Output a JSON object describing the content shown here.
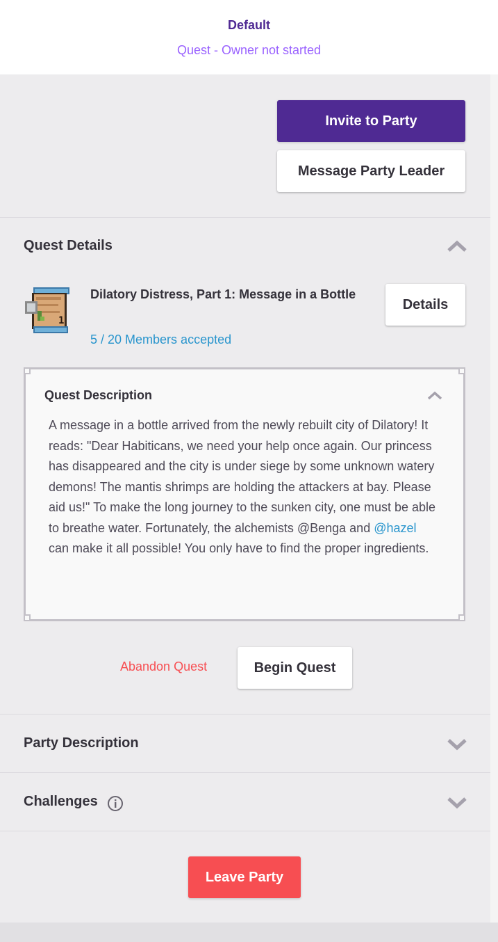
{
  "header": {
    "title": "Default",
    "subtitle": "Quest - Owner not started"
  },
  "actions": {
    "invite_label": "Invite to Party",
    "message_label": "Message Party Leader"
  },
  "quest_section": {
    "title": "Quest Details",
    "quest_name": "Dilatory Distress, Part 1: Message in a Bottle",
    "members_accepted": "5 / 20 Members accepted",
    "details_label": "Details",
    "description_title": "Quest Description",
    "description_part1": "A message in a bottle arrived from the newly rebuilt city of Dilatory! It reads: \"Dear Habiticans, we need your help once again. Our princess has disappeared and the city is under siege by some unknown watery demons! The mantis shrimps are holding the attackers at bay. Please aid us!\" To make the long journey to the sunken city, one must be able to breathe water. Fortunately, the alchemists @Benga and ",
    "description_mention": "@hazel",
    "description_part2": " can make it all possible! You only have to find the proper ingredients.",
    "abandon_label": "Abandon Quest",
    "begin_label": "Begin Quest"
  },
  "party_section": {
    "title": "Party Description"
  },
  "challenges_section": {
    "title": "Challenges"
  },
  "footer": {
    "leave_label": "Leave Party"
  },
  "colors": {
    "brand_purple": "#4f2a93",
    "accent_purple": "#9a62ff",
    "link_blue": "#2995cd",
    "danger_red": "#f74e52"
  },
  "icons": {
    "quest_image": "scroll-bottle-icon",
    "collapse": "chevron-up-icon",
    "expand": "chevron-down-icon",
    "info": "info-icon"
  }
}
